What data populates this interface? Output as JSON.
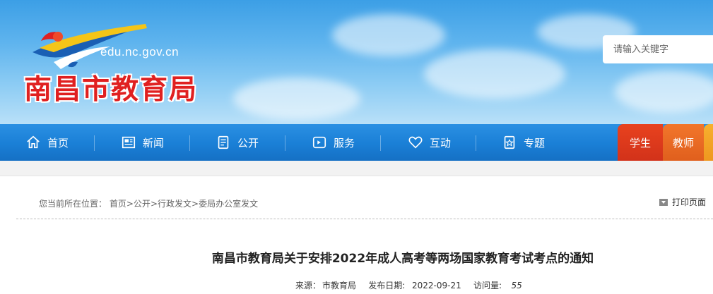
{
  "header": {
    "domain": "edu.nc.gov.cn",
    "site_name": "南昌市教育局",
    "search_placeholder": "请输入关键字"
  },
  "nav": {
    "items": [
      {
        "label": "首页",
        "icon": "home-icon"
      },
      {
        "label": "新闻",
        "icon": "newspaper-icon"
      },
      {
        "label": "公开",
        "icon": "document-icon"
      },
      {
        "label": "服务",
        "icon": "service-icon"
      },
      {
        "label": "互动",
        "icon": "heart-icon"
      },
      {
        "label": "专题",
        "icon": "topic-icon"
      }
    ],
    "roles": [
      {
        "label": "学生"
      },
      {
        "label": "教师"
      }
    ]
  },
  "breadcrumb": {
    "prefix": "您当前所在位置：",
    "items": [
      "首页",
      "公开",
      "行政发文",
      "委局办公室发文"
    ],
    "separator": ">"
  },
  "print_label": "打印页面",
  "article": {
    "title": "南昌市教育局关于安排2022年成人高考等两场国家教育考试考点的通知",
    "source_label": "来源：",
    "source": "市教育局",
    "date_label": "发布日期:",
    "date": "2022-09-21",
    "views_label": "访问量:",
    "views": "55"
  },
  "colors": {
    "nav_blue": "#1a7fd6",
    "site_name_red": "#e02020",
    "student_tab": "#e8421e",
    "teacher_tab": "#f2762b"
  }
}
